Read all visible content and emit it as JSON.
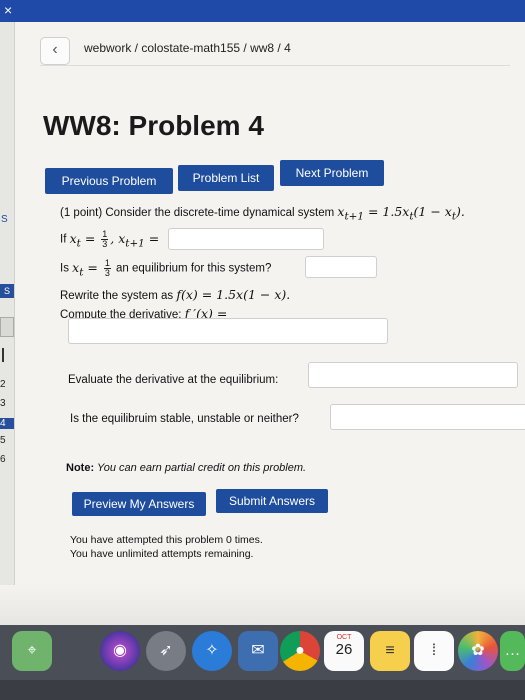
{
  "window": {
    "close_glyph": "×",
    "accent": "#1f4aa8"
  },
  "nav": {
    "s": "S",
    "s2": "S",
    "numbers": [
      "2",
      "3",
      "4",
      "5",
      "6"
    ],
    "active_number": "4"
  },
  "breadcrumb": {
    "back_icon": "chevron-left-icon",
    "path": "webwork / colostate-math155 / ww8 / 4"
  },
  "page": {
    "title": "WW8: Problem 4"
  },
  "buttons": {
    "previous": "Previous Problem",
    "list": "Problem List",
    "next": "Next Problem",
    "preview": "Preview My Answers",
    "submit": "Submit Answers"
  },
  "problem": {
    "line1_text": "(1 point) Consider the discrete-time dynamical system ",
    "line1_math": "x",
    "line1_math_sub": "t+1",
    "line1_math_rest": " = 1.5x",
    "line1_sub2": "t",
    "line1_paren": "(1 − x",
    "line1_sub3": "t",
    "line1_end": ").",
    "line2_prefix": "If ",
    "line2_x": "x",
    "line2_sub": "t",
    "line2_eq": " = ",
    "frac_n": "1",
    "frac_d": "3",
    "line2_next": ", x",
    "line2_next_sub": "t+1",
    "line2_next_eq": " =",
    "line3_prefix": "Is ",
    "line3_x": "x",
    "line3_sub": "t",
    "line3_eq": " = ",
    "line3_rest": " an equilibrium for this system?",
    "line4_text": "Rewrite the system as ",
    "line4_math": "f(x) = 1.5x(1 − x).",
    "line5_text": "Compute the derivative: ",
    "line5_math": "f ′(x) =",
    "q_evaluate": "Evaluate the derivative at the equilibrium:",
    "q_stable": "Is the equilibruim stable, unstable or neither?"
  },
  "note": {
    "label": "Note:",
    "text": " You can earn partial credit on this problem."
  },
  "attempts": {
    "line1": "You have attempted this problem 0 times.",
    "line2": "You have unlimited attempts remaining."
  },
  "dock": {
    "calendar_month": "OCT",
    "calendar_day": "26",
    "icons": [
      "maps-icon",
      "siri-icon",
      "launchpad-icon",
      "safari-icon",
      "mail-icon",
      "chrome-icon",
      "calendar-icon",
      "notes-icon",
      "reminders-icon",
      "photos-icon",
      "messages-icon"
    ]
  }
}
